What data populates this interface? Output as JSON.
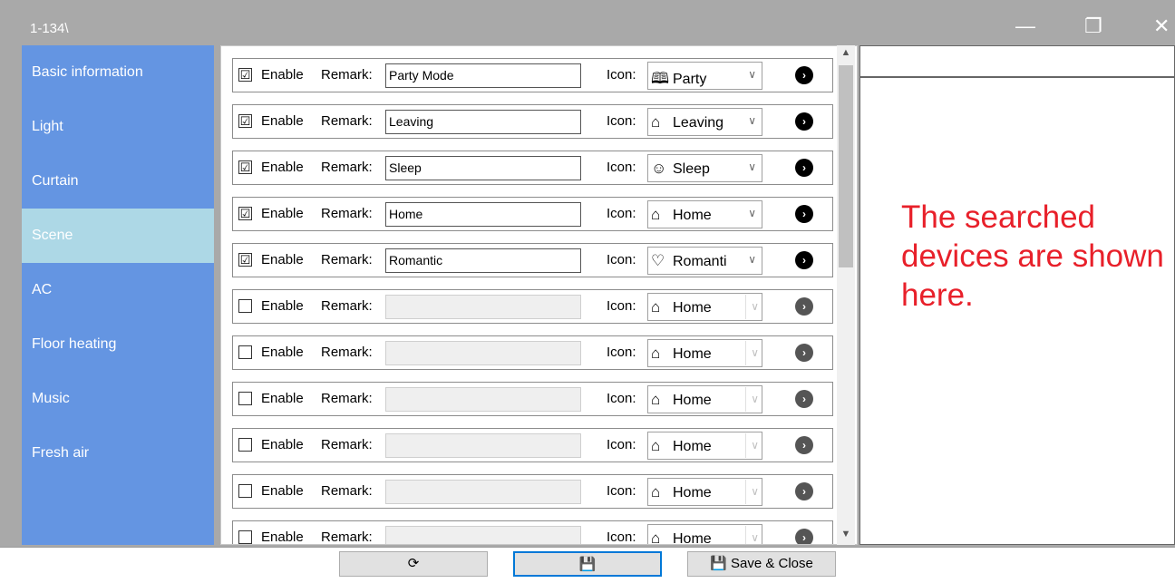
{
  "window": {
    "title": "1-134\\",
    "minimize": "—",
    "maximize": "❐",
    "close": "✕"
  },
  "sidebar": {
    "items": [
      {
        "label": "Basic information"
      },
      {
        "label": "Light"
      },
      {
        "label": "Curtain"
      },
      {
        "label": "Scene",
        "active": true
      },
      {
        "label": "AC"
      },
      {
        "label": "Floor heating"
      },
      {
        "label": "Music"
      },
      {
        "label": "Fresh air"
      }
    ]
  },
  "scene_rows": {
    "enable_label": "Enable",
    "remark_label": "Remark:",
    "icon_label": "Icon:",
    "rows": [
      {
        "enabled": true,
        "checkmark": "☑",
        "remark": "Party Mode",
        "icon_glyph": "🕮",
        "icon_name": "Party"
      },
      {
        "enabled": true,
        "checkmark": "☑",
        "remark": "Leaving",
        "icon_glyph": "⌂",
        "icon_name": "Leaving"
      },
      {
        "enabled": true,
        "checkmark": "☑",
        "remark": "Sleep",
        "icon_glyph": "☺",
        "icon_name": "Sleep"
      },
      {
        "enabled": true,
        "checkmark": "☑",
        "remark": "Home",
        "icon_glyph": "⌂",
        "icon_name": "Home"
      },
      {
        "enabled": true,
        "checkmark": "☑",
        "remark": "Romantic",
        "icon_glyph": "♡",
        "icon_name": "Romanti"
      },
      {
        "enabled": false,
        "checkmark": "",
        "remark": "",
        "icon_glyph": "⌂",
        "icon_name": "Home"
      },
      {
        "enabled": false,
        "checkmark": "",
        "remark": "",
        "icon_glyph": "⌂",
        "icon_name": "Home"
      },
      {
        "enabled": false,
        "checkmark": "",
        "remark": "",
        "icon_glyph": "⌂",
        "icon_name": "Home"
      },
      {
        "enabled": false,
        "checkmark": "",
        "remark": "",
        "icon_glyph": "⌂",
        "icon_name": "Home"
      },
      {
        "enabled": false,
        "checkmark": "",
        "remark": "",
        "icon_glyph": "⌂",
        "icon_name": "Home"
      },
      {
        "enabled": false,
        "checkmark": "",
        "remark": "",
        "icon_glyph": "⌂",
        "icon_name": "Home"
      }
    ]
  },
  "right_panel": {
    "note": "The searched devices are shown here."
  },
  "buttons": {
    "refresh_glyph": "⟳",
    "save_glyph": "💾",
    "save_close_label": "Save & Close"
  },
  "colors": {
    "sidebar": "#6495e2",
    "sidebar_active": "#add8e6",
    "note": "#e8202a"
  }
}
